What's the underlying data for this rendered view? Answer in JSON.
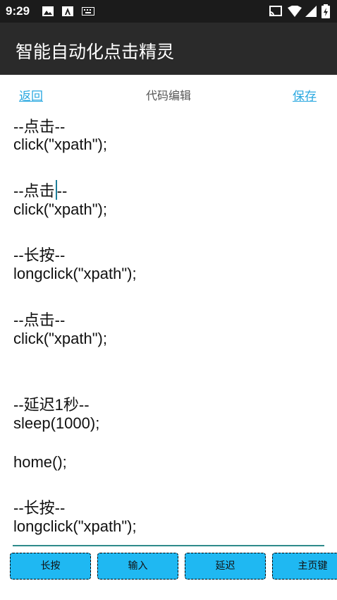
{
  "status": {
    "time": "9:29"
  },
  "app": {
    "title": "智能自动化点击精灵"
  },
  "toolbar": {
    "back_label": "返回",
    "title": "代码编辑",
    "save_label": "保存"
  },
  "editor": {
    "lines": [
      "--点击--",
      "click(\"xpath\");",
      "--点击",
      "--",
      "click(\"xpath\");",
      "--长按--",
      "longclick(\"xpath\");",
      "--点击--",
      "click(\"xpath\");",
      "--延迟1秒--",
      "sleep(1000);",
      "home();",
      "--长按--",
      "longclick(\"xpath\");"
    ]
  },
  "buttons": [
    {
      "label": "长按"
    },
    {
      "label": "输入"
    },
    {
      "label": "延迟"
    },
    {
      "label": "主页键"
    }
  ]
}
